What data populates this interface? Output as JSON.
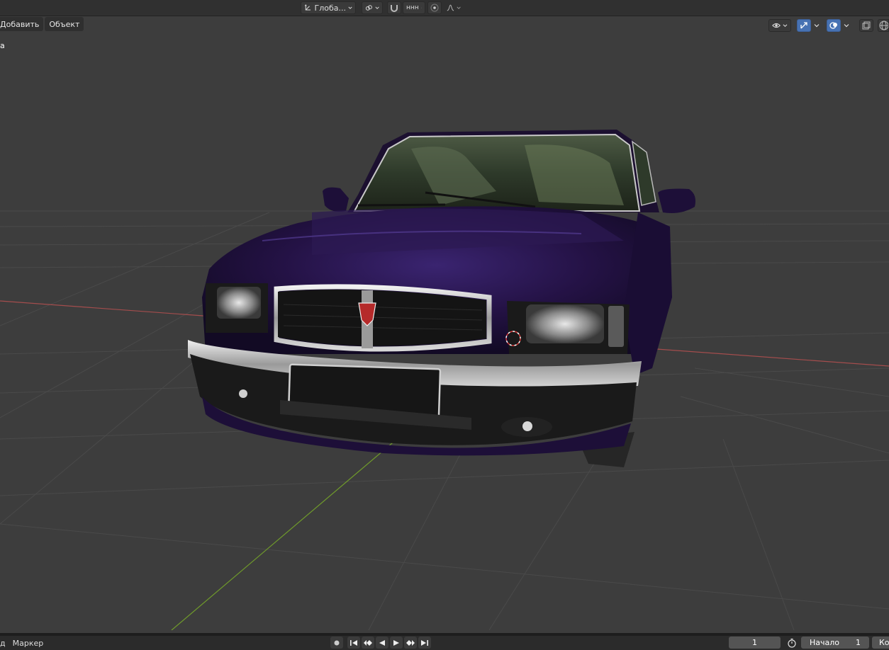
{
  "header": {
    "orientation_label": "Глоба...",
    "snap_label": "ннн"
  },
  "viewport": {
    "menu": {
      "add_label": "Добавить",
      "object_label": "Объект"
    },
    "object_name": "а"
  },
  "timeline": {
    "left_partial_label": "д",
    "marker_label": "Маркер",
    "current_frame": "1",
    "start_label": "Начало",
    "start_value": "1",
    "end_partial_label": "Ко"
  },
  "colors": {
    "car_body": "#241245",
    "grid_line": "#4a4a4a",
    "x_axis": "#a44d4d",
    "y_axis": "#6f9a2b",
    "active_tool": "#4772b3"
  }
}
